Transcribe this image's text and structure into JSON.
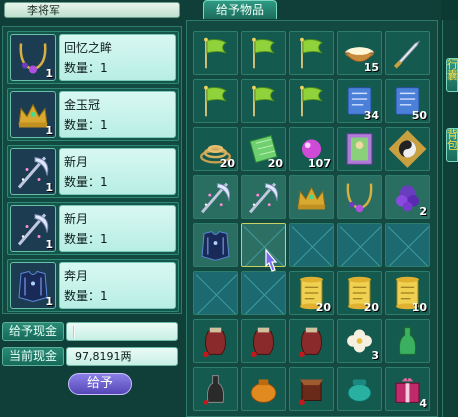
{
  "header": {
    "player_name": "李将军"
  },
  "tab": {
    "label": "给予物品"
  },
  "selected_items": [
    {
      "name": "回忆之眸",
      "count_label": "数量：1",
      "qty": "1",
      "icon": "necklace-icon"
    },
    {
      "name": "金玉冠",
      "count_label": "数量：1",
      "qty": "1",
      "icon": "crown-icon"
    },
    {
      "name": "新月",
      "count_label": "数量：1",
      "qty": "1",
      "icon": "crescent-blade-icon"
    },
    {
      "name": "新月",
      "count_label": "数量：1",
      "qty": "1",
      "icon": "crescent-blade-icon"
    },
    {
      "name": "奔月",
      "count_label": "数量：1",
      "qty": "1",
      "icon": "armor-icon"
    }
  ],
  "money": {
    "give_label": "给予现金",
    "give_value": "",
    "current_label": "当前现金",
    "current_value": "97,8191两"
  },
  "give_button": {
    "label": "给予"
  },
  "side_tabs": [
    "行囊",
    "背包"
  ],
  "inventory": [
    {
      "icon": "flag-icon",
      "qty": ""
    },
    {
      "icon": "flag-icon",
      "qty": ""
    },
    {
      "icon": "flag-icon",
      "qty": ""
    },
    {
      "icon": "rice-bowl-icon",
      "qty": "15"
    },
    {
      "icon": "dagger-icon",
      "qty": ""
    },
    {
      "icon": "flag-icon",
      "qty": ""
    },
    {
      "icon": "flag-icon",
      "qty": ""
    },
    {
      "icon": "flag-icon",
      "qty": ""
    },
    {
      "icon": "scroll-blue-icon",
      "qty": "34"
    },
    {
      "icon": "scroll-blue-icon",
      "qty": "50"
    },
    {
      "icon": "incense-coil-icon",
      "qty": "20"
    },
    {
      "icon": "green-cloth-icon",
      "qty": "20"
    },
    {
      "icon": "pearl-icon",
      "qty": "107"
    },
    {
      "icon": "portrait-card-icon",
      "qty": ""
    },
    {
      "icon": "yinyang-icon",
      "qty": ""
    },
    {
      "icon": "crescent-blade-icon",
      "qty": ""
    },
    {
      "icon": "crescent-blade-icon",
      "qty": ""
    },
    {
      "icon": "crown-icon",
      "qty": ""
    },
    {
      "icon": "necklace-icon",
      "qty": ""
    },
    {
      "icon": "grapes-icon",
      "qty": "2"
    },
    {
      "icon": "armor-icon",
      "qty": ""
    },
    {
      "icon": "empty",
      "qty": ""
    },
    {
      "icon": "empty",
      "qty": ""
    },
    {
      "icon": "empty",
      "qty": ""
    },
    {
      "icon": "empty",
      "qty": ""
    },
    {
      "icon": "empty",
      "qty": ""
    },
    {
      "icon": "empty",
      "qty": ""
    },
    {
      "icon": "yellow-scroll-icon",
      "qty": "20"
    },
    {
      "icon": "yellow-scroll-icon",
      "qty": "20"
    },
    {
      "icon": "yellow-scroll-icon",
      "qty": "10"
    },
    {
      "icon": "wine-jar-icon",
      "qty": ""
    },
    {
      "icon": "wine-jar-icon",
      "qty": ""
    },
    {
      "icon": "wine-jar-icon",
      "qty": ""
    },
    {
      "icon": "white-flower-icon",
      "qty": "3"
    },
    {
      "icon": "green-bottle-icon",
      "qty": ""
    },
    {
      "icon": "dark-bottle-icon",
      "qty": ""
    },
    {
      "icon": "orange-pot-icon",
      "qty": ""
    },
    {
      "icon": "meat-jar-icon",
      "qty": ""
    },
    {
      "icon": "jade-pot-icon",
      "qty": ""
    },
    {
      "icon": "gift-box-icon",
      "qty": "4"
    }
  ],
  "colors": {
    "panel": "#124a41",
    "accent": "#2f9a84",
    "button": "#6a5ccc"
  }
}
